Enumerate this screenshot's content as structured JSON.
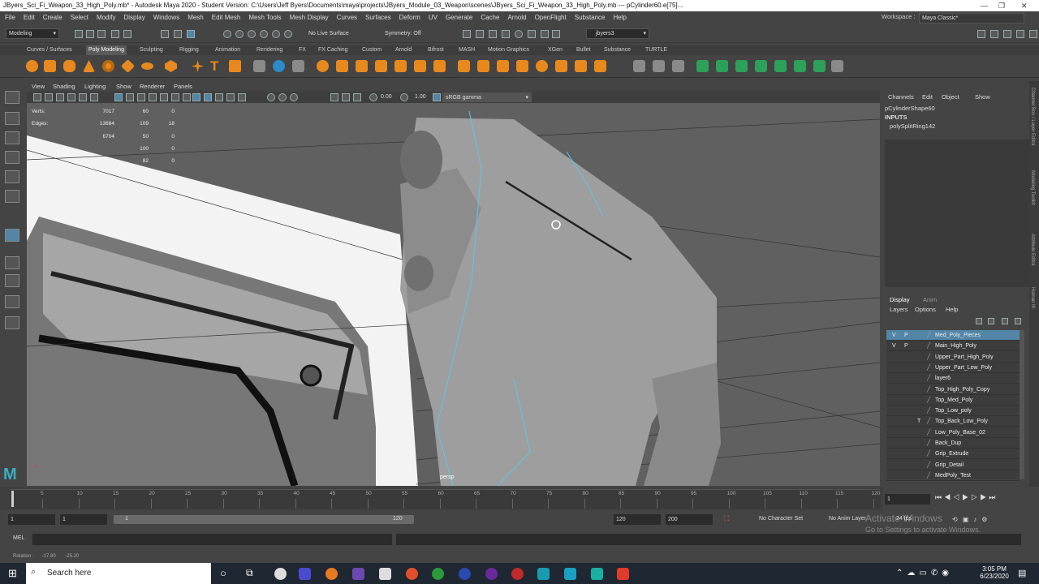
{
  "window": {
    "title": "JByers_Sci_Fi_Weapon_33_High_Poly.mb* - Autodesk Maya 2020 - Student Version: C:\\Users\\Jeff Byers\\Documents\\maya\\projects\\JByers_Module_03_Weapon\\scenes\\JByers_Sci_Fi_Weapon_33_High_Poly.mb  ---  pCylinder60.e[75]..."
  },
  "menubar": [
    "File",
    "Edit",
    "Create",
    "Select",
    "Modify",
    "Display",
    "Windows",
    "Mesh",
    "Edit Mesh",
    "Mesh Tools",
    "Mesh Display",
    "Curves",
    "Surfaces",
    "Deform",
    "UV",
    "Generate",
    "Cache",
    "Arnold",
    "OpenFlight",
    "Substance",
    "Help"
  ],
  "workspace": {
    "label": "Workspace :",
    "value": "Maya Classic*"
  },
  "statusline": {
    "mode": "Modeling",
    "live_surface": "No Live Surface",
    "symmetry": "Symmetry: Off",
    "user": "jbyers3"
  },
  "shelf_tabs": [
    "Curves / Surfaces",
    "Poly Modeling",
    "Sculpting",
    "Rigging",
    "Animation",
    "Rendering",
    "FX",
    "FX Caching",
    "Custom",
    "Arnold",
    "Bifrost",
    "MASH",
    "Motion Graphics",
    "XGen",
    "Bullet",
    "Substance",
    "TURTLE"
  ],
  "viewport": {
    "menu": [
      "View",
      "Shading",
      "Lighting",
      "Show",
      "Renderer",
      "Panels"
    ],
    "toolbar": {
      "val1": "0.00",
      "val2": "1.00",
      "color_space": "sRGB gamma"
    },
    "hud": [
      {
        "label": "Verts:",
        "a": "7017",
        "b": "60",
        "c": "0"
      },
      {
        "label": "Edges:",
        "a": "13684",
        "b": "109",
        "c": "18"
      },
      {
        "label": "",
        "a": "6704",
        "b": "50",
        "c": "0"
      },
      {
        "label": "",
        "a": "",
        "b": "100",
        "c": "0"
      },
      {
        "label": "",
        "a": "",
        "b": "82",
        "c": "0"
      }
    ],
    "camera": "persp"
  },
  "channel_box": {
    "menu": [
      "Channels",
      "Edit",
      "Object",
      "Show"
    ],
    "shape": "pCylinderShape60",
    "inputs": "INPUTS",
    "node": "polySplitRing142",
    "side_tabs": [
      "Channel Box / Layer Editor",
      "Modeling Toolkit",
      "Attribute Editor",
      "Human IK"
    ]
  },
  "layer_editor": {
    "tabs": [
      "Display",
      "Anim"
    ],
    "menu": [
      "Layers",
      "Options",
      "Help"
    ],
    "layers": [
      {
        "v": "V",
        "p": "P",
        "t": "",
        "name": "Med_Poly_Pieces",
        "selected": true
      },
      {
        "v": "V",
        "p": "P",
        "t": "",
        "name": "Main_High_Poly"
      },
      {
        "v": "",
        "p": "",
        "t": "",
        "name": "Upper_Part_High_Poly"
      },
      {
        "v": "",
        "p": "",
        "t": "",
        "name": "Upper_Part_Low_Poly"
      },
      {
        "v": "",
        "p": "",
        "t": "",
        "name": "layer6"
      },
      {
        "v": "",
        "p": "",
        "t": "",
        "name": "Top_High_Poly_Copy"
      },
      {
        "v": "",
        "p": "",
        "t": "",
        "name": "Top_Med_Poly"
      },
      {
        "v": "",
        "p": "",
        "t": "",
        "name": "Top_Low_poly"
      },
      {
        "v": "",
        "p": "",
        "t": "T",
        "name": "Top_Back_Low_Poly"
      },
      {
        "v": "",
        "p": "",
        "t": "",
        "name": "Low_Poly_Base_02"
      },
      {
        "v": "",
        "p": "",
        "t": "",
        "name": "Back_Dup"
      },
      {
        "v": "",
        "p": "",
        "t": "",
        "name": "Grip_Extrude"
      },
      {
        "v": "",
        "p": "",
        "t": "",
        "name": "Grip_Detail"
      },
      {
        "v": "",
        "p": "",
        "t": "",
        "name": "MedPoly_Test"
      }
    ]
  },
  "timeline": {
    "ticks": [
      "5",
      "10",
      "15",
      "20",
      "25",
      "30",
      "35",
      "40",
      "45",
      "50",
      "55",
      "60",
      "65",
      "70",
      "75",
      "80",
      "85",
      "90",
      "95",
      "100",
      "105",
      "110",
      "115",
      "120"
    ],
    "current_frame": "1",
    "range_start": "1",
    "range_start2": "1",
    "range_slider_start": "1",
    "range_slider_end": "120",
    "range_end": "120",
    "anim_end": "200",
    "character_set": "No Character Set",
    "anim_layer": "No Anim Layer",
    "fps": "24 fps"
  },
  "mel_label": "MEL",
  "help_line": {
    "label": "Rotation:",
    "x": "-17.80",
    "y": "-25.20"
  },
  "watermark": {
    "line1": "Activate Windows",
    "line2": "Go to Settings to activate Windows."
  },
  "taskbar": {
    "search": "Search here",
    "time": "3:05 PM",
    "date": "6/23/2020"
  },
  "colors": {
    "accent": "#5285a6",
    "shelf_orange": "#e8891e",
    "shelf_green": "#2da05a",
    "highlight": "#2a8cc8"
  }
}
